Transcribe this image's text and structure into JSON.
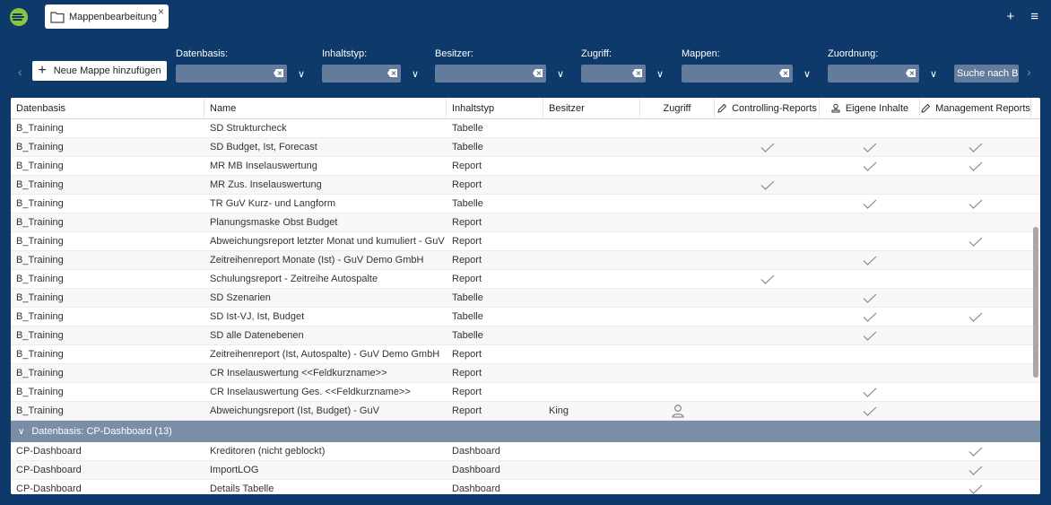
{
  "app": {
    "tab_title": "Mappenbearbeitung",
    "tab_close": "×",
    "plus": "+",
    "menu": "≡"
  },
  "toolbar": {
    "add_label": "Neue Mappe hinzufügen",
    "search_label": "Suche nach Beric",
    "filters": [
      "Datenbasis:",
      "Inhaltstyp:",
      "Besitzer:",
      "Zugriff:",
      "Mappen:",
      "Zuordnung:"
    ]
  },
  "grid": {
    "headers": [
      "Datenbasis",
      "Name",
      "Inhaltstyp",
      "Besitzer",
      "Zugriff",
      "Controlling-Reports",
      "Eigene Inhalte",
      "Management Reports"
    ],
    "rows": [
      {
        "db": "B_Training",
        "name": "SD Strukturcheck",
        "type": "Tabelle",
        "owner": "",
        "access": false,
        "c": false,
        "e": false,
        "m": false
      },
      {
        "db": "B_Training",
        "name": "SD Budget, Ist, Forecast",
        "type": "Tabelle",
        "owner": "",
        "access": false,
        "c": true,
        "e": true,
        "m": true
      },
      {
        "db": "B_Training",
        "name": "MR MB Inselauswertung",
        "type": "Report",
        "owner": "",
        "access": false,
        "c": false,
        "e": true,
        "m": true
      },
      {
        "db": "B_Training",
        "name": "MR Zus. Inselauswertung",
        "type": "Report",
        "owner": "",
        "access": false,
        "c": true,
        "e": false,
        "m": false
      },
      {
        "db": "B_Training",
        "name": "TR GuV Kurz- und Langform",
        "type": "Tabelle",
        "owner": "",
        "access": false,
        "c": false,
        "e": true,
        "m": true
      },
      {
        "db": "B_Training",
        "name": "Planungsmaske Obst Budget",
        "type": "Report",
        "owner": "",
        "access": false,
        "c": false,
        "e": false,
        "m": false
      },
      {
        "db": "B_Training",
        "name": "Abweichungsreport letzter Monat und kumuliert - GuV De...",
        "type": "Report",
        "owner": "",
        "access": false,
        "c": false,
        "e": false,
        "m": true
      },
      {
        "db": "B_Training",
        "name": "Zeitreihenreport Monate (Ist) - GuV Demo GmbH",
        "type": "Report",
        "owner": "",
        "access": false,
        "c": false,
        "e": true,
        "m": false
      },
      {
        "db": "B_Training",
        "name": "Schulungsreport - Zeitreihe Autospalte",
        "type": "Report",
        "owner": "",
        "access": false,
        "c": true,
        "e": false,
        "m": false
      },
      {
        "db": "B_Training",
        "name": "SD Szenarien",
        "type": "Tabelle",
        "owner": "",
        "access": false,
        "c": false,
        "e": true,
        "m": false
      },
      {
        "db": "B_Training",
        "name": "SD Ist-VJ, Ist, Budget",
        "type": "Tabelle",
        "owner": "",
        "access": false,
        "c": false,
        "e": true,
        "m": true
      },
      {
        "db": "B_Training",
        "name": "SD alle Datenebenen",
        "type": "Tabelle",
        "owner": "",
        "access": false,
        "c": false,
        "e": true,
        "m": false
      },
      {
        "db": "B_Training",
        "name": "Zeitreihenreport (Ist, Autospalte) - GuV Demo GmbH",
        "type": "Report",
        "owner": "",
        "access": false,
        "c": false,
        "e": false,
        "m": false
      },
      {
        "db": "B_Training",
        "name": "CR Inselauswertung <<Feldkurzname>>",
        "type": "Report",
        "owner": "",
        "access": false,
        "c": false,
        "e": false,
        "m": false
      },
      {
        "db": "B_Training",
        "name": "CR Inselauswertung Ges. <<Feldkurzname>>",
        "type": "Report",
        "owner": "",
        "access": false,
        "c": false,
        "e": true,
        "m": false
      },
      {
        "db": "B_Training",
        "name": "Abweichungsreport (Ist, Budget) - GuV",
        "type": "Report",
        "owner": "King",
        "access": true,
        "c": false,
        "e": true,
        "m": false
      }
    ],
    "group_label": "Datenbasis: CP-Dashboard (13)",
    "group_rows": [
      {
        "db": "CP-Dashboard",
        "name": "Kreditoren (nicht geblockt)",
        "type": "Dashboard",
        "owner": "",
        "access": false,
        "c": false,
        "e": false,
        "m": true
      },
      {
        "db": "CP-Dashboard",
        "name": "ImportLOG",
        "type": "Dashboard",
        "owner": "",
        "access": false,
        "c": false,
        "e": false,
        "m": true
      },
      {
        "db": "CP-Dashboard",
        "name": "Details Tabelle",
        "type": "Dashboard",
        "owner": "",
        "access": false,
        "c": false,
        "e": false,
        "m": true
      }
    ]
  },
  "colors": {
    "background": "#0e3a6b",
    "accent": "#8cc63f",
    "input": "#647c9c",
    "group": "#7a8ea8"
  }
}
